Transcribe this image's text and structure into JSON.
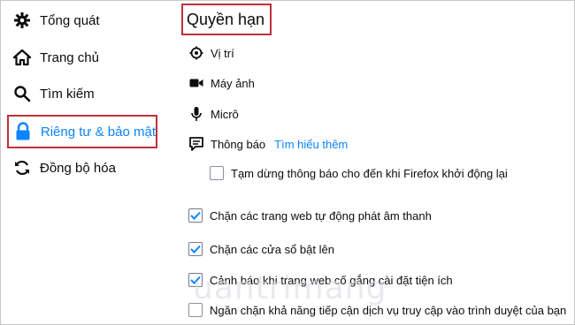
{
  "sidebar": {
    "items": [
      {
        "label": "Tổng quát",
        "icon": "gear-icon"
      },
      {
        "label": "Trang chủ",
        "icon": "home-icon"
      },
      {
        "label": "Tìm kiếm",
        "icon": "search-icon"
      },
      {
        "label": "Riêng tư & bảo mật",
        "icon": "lock-icon",
        "selected": true
      },
      {
        "label": "Đồng bộ hóa",
        "icon": "sync-icon"
      }
    ]
  },
  "main": {
    "section_title": "Quyền hạn",
    "permissions": [
      {
        "label": "Vị trí",
        "icon": "location-icon"
      },
      {
        "label": "Máy ảnh",
        "icon": "camera-icon"
      },
      {
        "label": "Micrô",
        "icon": "microphone-icon"
      },
      {
        "label": "Thông báo",
        "icon": "notification-icon",
        "link": "Tìm hiểu thêm"
      }
    ],
    "pause_notifications": {
      "label": "Tạm dừng thông báo cho đến khi Firefox khởi động lại",
      "checked": false
    },
    "checkboxes": [
      {
        "label": "Chặn các trang web tự động phát âm thanh",
        "checked": true
      },
      {
        "label": "Chặn các cửa sổ bật lên",
        "checked": true
      },
      {
        "label": "Cảnh báo khi trang web cố gắng cài đặt tiện ích",
        "checked": true
      },
      {
        "label": "Ngăn chặn khả năng tiếp cận dịch vụ truy cập vào trình duyệt của bạn",
        "checked": false
      }
    ]
  },
  "watermark": "uantrimang",
  "colors": {
    "accent": "#0a84ff",
    "highlight_border": "#c0303a"
  }
}
